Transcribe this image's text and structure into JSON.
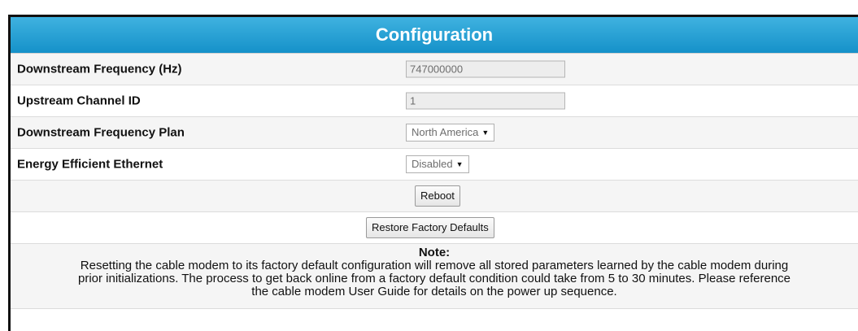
{
  "header": {
    "title": "Configuration"
  },
  "fields": {
    "downstream_frequency": {
      "label": "Downstream Frequency (Hz)",
      "value": "747000000"
    },
    "upstream_channel": {
      "label": "Upstream Channel ID",
      "value": "1"
    },
    "frequency_plan": {
      "label": "Downstream Frequency Plan",
      "selected": "North America"
    },
    "energy_efficient": {
      "label": "Energy Efficient Ethernet",
      "selected": "Disabled"
    }
  },
  "buttons": {
    "reboot": "Reboot",
    "restore": "Restore Factory Defaults"
  },
  "note": {
    "title": "Note:",
    "body": "Resetting the cable modem to its factory default configuration will remove all stored parameters learned by the cable modem during\nprior initializations. The process to get back online from a factory default condition could take from 5 to 30 minutes. Please reference\nthe cable modem User Guide for details on the power up sequence."
  },
  "colors": {
    "header_bg": "#1e9bd4",
    "header_text": "#ffffff"
  },
  "icons": {
    "select_caret": "caret-down-icon"
  }
}
